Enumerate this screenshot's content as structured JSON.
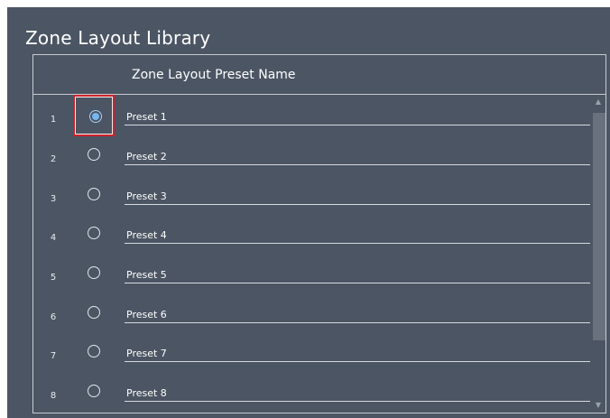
{
  "window": {
    "title": "Zone Layout Library"
  },
  "table": {
    "header": "Zone Layout Preset Name",
    "rows": [
      {
        "index": "1",
        "name": "Preset 1",
        "selected": true
      },
      {
        "index": "2",
        "name": "Preset 2",
        "selected": false
      },
      {
        "index": "3",
        "name": "Preset 3",
        "selected": false
      },
      {
        "index": "4",
        "name": "Preset 4",
        "selected": false
      },
      {
        "index": "5",
        "name": "Preset 5",
        "selected": false
      },
      {
        "index": "6",
        "name": "Preset 6",
        "selected": false
      },
      {
        "index": "7",
        "name": "Preset 7",
        "selected": false
      },
      {
        "index": "8",
        "name": "Preset 8",
        "selected": false
      }
    ]
  },
  "scrollbar": {
    "up_icon": "chevron-up-icon",
    "down_icon": "chevron-down-icon"
  },
  "colors": {
    "background": "#4b5563",
    "border": "#c8ccd2",
    "selected_radio": "#77b7f0",
    "focus_border": "#d0222a"
  }
}
